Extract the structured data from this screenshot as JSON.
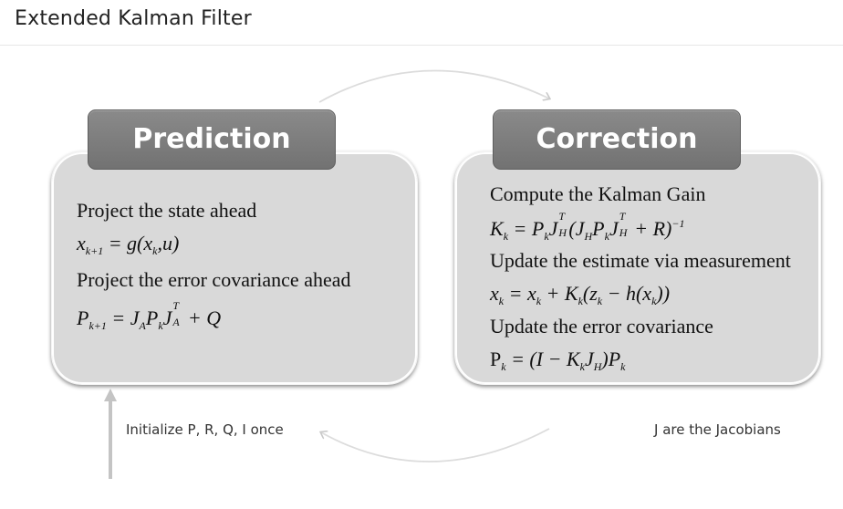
{
  "page": {
    "title": "Extended Kalman Filter"
  },
  "prediction": {
    "header": "Prediction",
    "step1": "Project the state ahead",
    "step2": "Project the error covariance ahead"
  },
  "correction": {
    "header": "Correction",
    "step1": "Compute the Kalman Gain",
    "step2": "Update the estimate via measurement",
    "step3": "Update the error covariance"
  },
  "notes": {
    "init": "Initialize P, R, Q, I once",
    "jacobians": "J are the Jacobians"
  }
}
